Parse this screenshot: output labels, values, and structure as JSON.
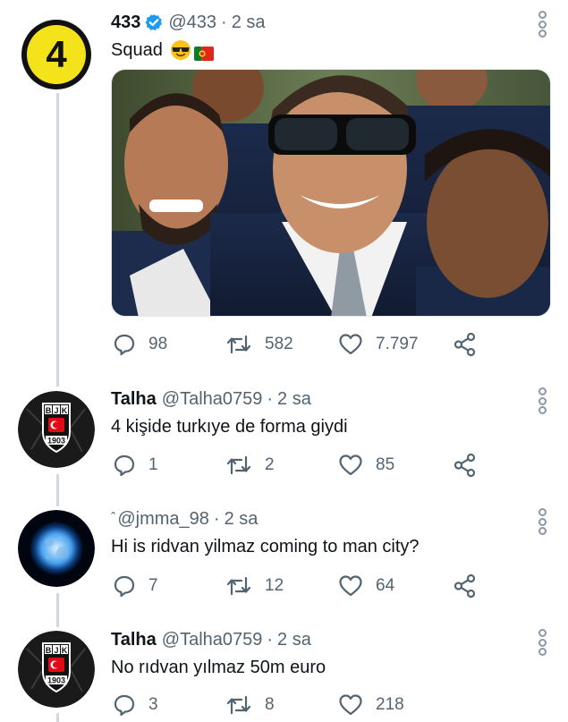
{
  "tweets": [
    {
      "name": "433",
      "handle": "@433",
      "dot": "·",
      "time": "2 sa",
      "text": "Squad",
      "emoji": [
        "sunglasses-emoji",
        "portugal-flag-emoji"
      ],
      "avatar_label": "4",
      "replies": "98",
      "retweets": "582",
      "likes": "7.797"
    },
    {
      "name": "Talha",
      "handle": "@Talha0759",
      "dot": "·",
      "time": "2 sa",
      "text": "4 kişide turkıye de forma giydi",
      "avatar_lettering": "BJK 1903",
      "replies": "1",
      "retweets": "2",
      "likes": "85"
    },
    {
      "name": "ˆ",
      "handle": "@jmma_98",
      "dot": "·",
      "time": "2 sa",
      "text": "Hi is ridvan yilmaz coming to man city?",
      "replies": "7",
      "retweets": "12",
      "likes": "64"
    },
    {
      "name": "Talha",
      "handle": "@Talha0759",
      "dot": "·",
      "time": "2 sa",
      "text": "No rıdvan yılmaz 50m euro",
      "avatar_lettering": "BJK 1903",
      "replies": "3",
      "retweets": "8",
      "likes": "218"
    }
  ],
  "colors": {
    "text": "#0f1419",
    "secondary": "#536471",
    "verified": "#1d9bf0",
    "thread_line": "#cfd9de",
    "badge_yellow": "#f4e21b"
  },
  "icons": [
    "reply-icon",
    "retweet-icon",
    "like-icon",
    "share-icon",
    "more-icon",
    "verified-icon"
  ]
}
